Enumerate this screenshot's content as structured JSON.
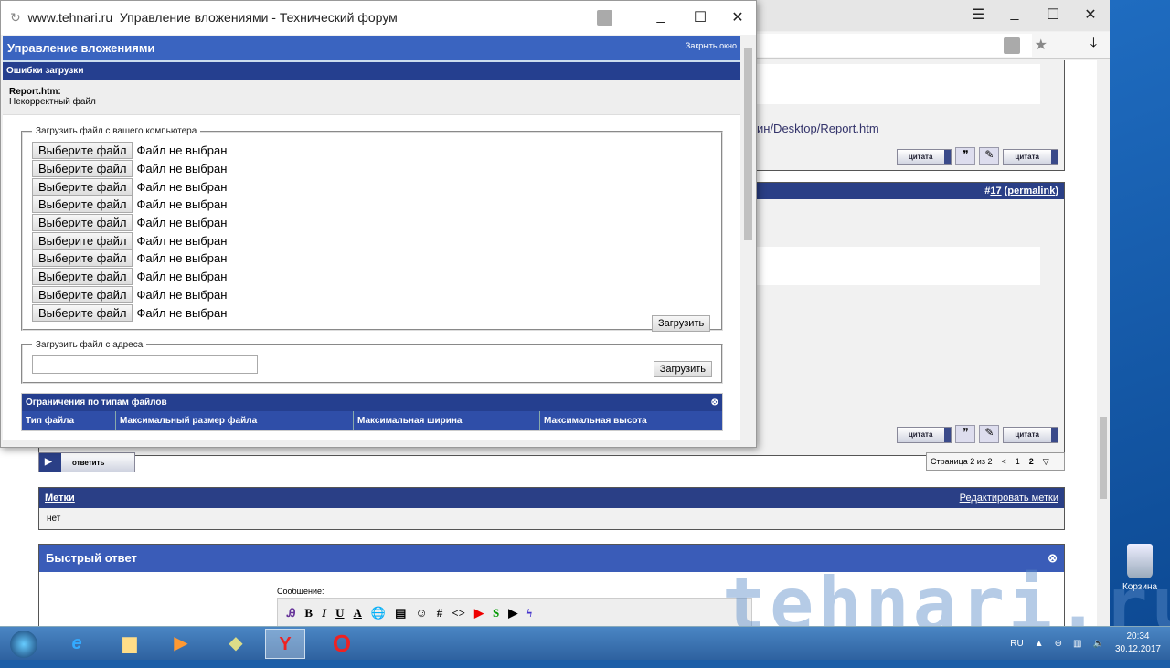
{
  "popup": {
    "url": "www.tehnari.ru",
    "title": "Управление вложениями - Технический форум",
    "header": "Управление вложениями",
    "close_link": "Закрыть окно",
    "errors_header": "Ошибки загрузки",
    "error_file": "Report.htm:",
    "error_msg": "Некорректный файл",
    "upload_legend": "Загрузить файл с вашего компьютера",
    "choose_label": "Выберите файл",
    "no_file": "Файл не выбран",
    "file_rows": 10,
    "upload_button": "Загрузить",
    "url_legend": "Загрузить файл с адреса",
    "url_value": "",
    "restrictions_header": "Ограничения по типам файлов",
    "columns": [
      "Тип файла",
      "Максимальный размер файла",
      "Максимальная ширина",
      "Максимальная высота"
    ]
  },
  "forum": {
    "link": "ин/Desktop/Report.htm",
    "quote": "цитата",
    "post_number_prefix": "#",
    "post_number": "17",
    "permalink": "permalink",
    "reply": "ответить",
    "pager": {
      "label": "Страница 2 из 2",
      "prev": "<",
      "pages": [
        "1",
        "2"
      ]
    },
    "tags_header": "Метки",
    "edit_tags": "Редактировать метки",
    "tags_value": "нет",
    "quick_reply": "Быстрый ответ",
    "message_label": "Сообщение:",
    "toolbar": [
      "B",
      "I",
      "U",
      "A",
      "#",
      "<>"
    ]
  },
  "desktop": {
    "recycle_bin": "Корзина",
    "watermark": "tehnari.ru",
    "lang": "RU",
    "time": "20:34",
    "date": "30.12.2017"
  }
}
